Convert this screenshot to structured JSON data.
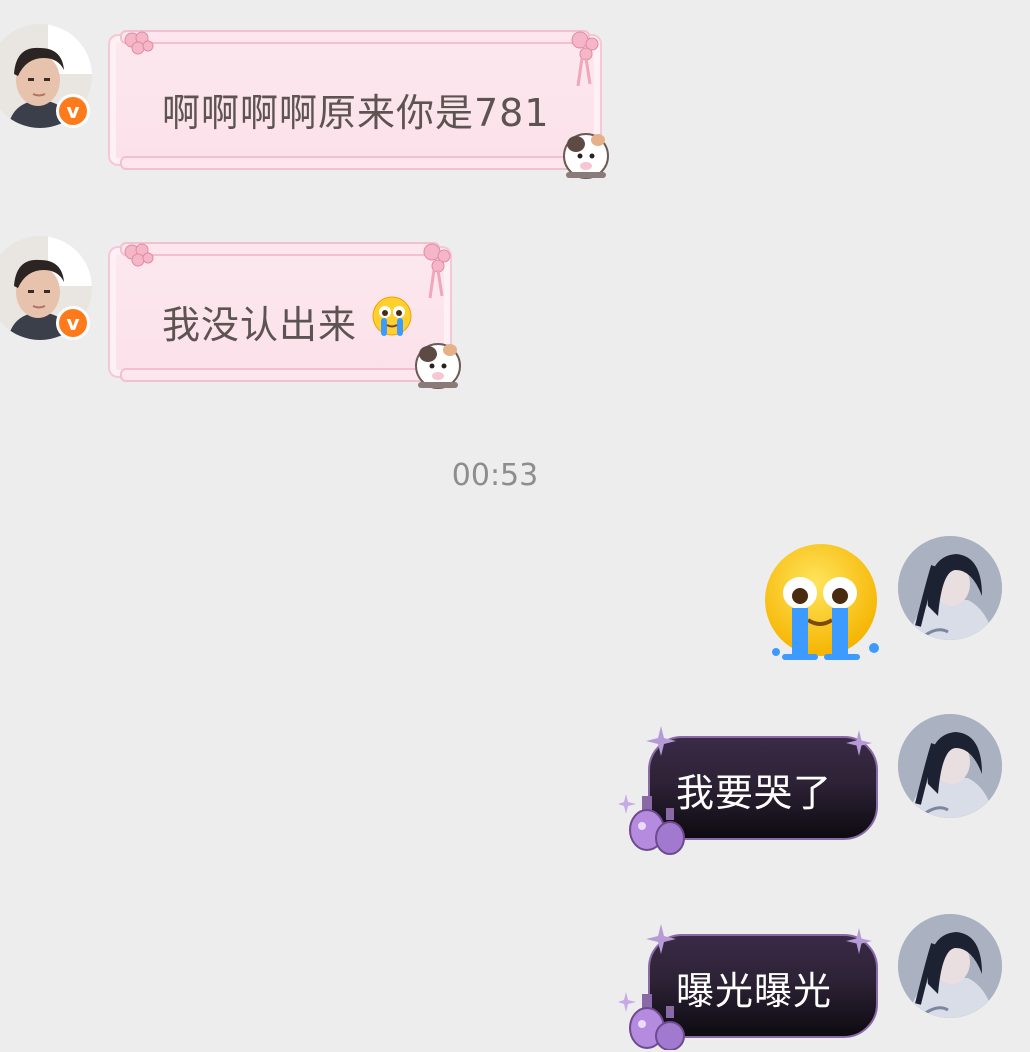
{
  "messages": [
    {
      "side": "left",
      "text": "啊啊啊啊原来你是781"
    },
    {
      "side": "left",
      "text": "我没认出来",
      "inline_emoji": "crying-emoji"
    },
    {
      "side": "right",
      "type": "sticker",
      "emoji": "crying-emoji"
    },
    {
      "side": "right",
      "text": "我要哭了"
    },
    {
      "side": "right",
      "text": "曝光曝光"
    }
  ],
  "timestamp": "00:53",
  "verified_badge": "v",
  "colors": {
    "background": "#ededed",
    "pink_bubble": "#fde8ef",
    "pink_border": "#f6c7d6",
    "dark_bubble": "#2d2236",
    "badge": "#ff7a1a",
    "timestamp": "#8d8d8d"
  }
}
